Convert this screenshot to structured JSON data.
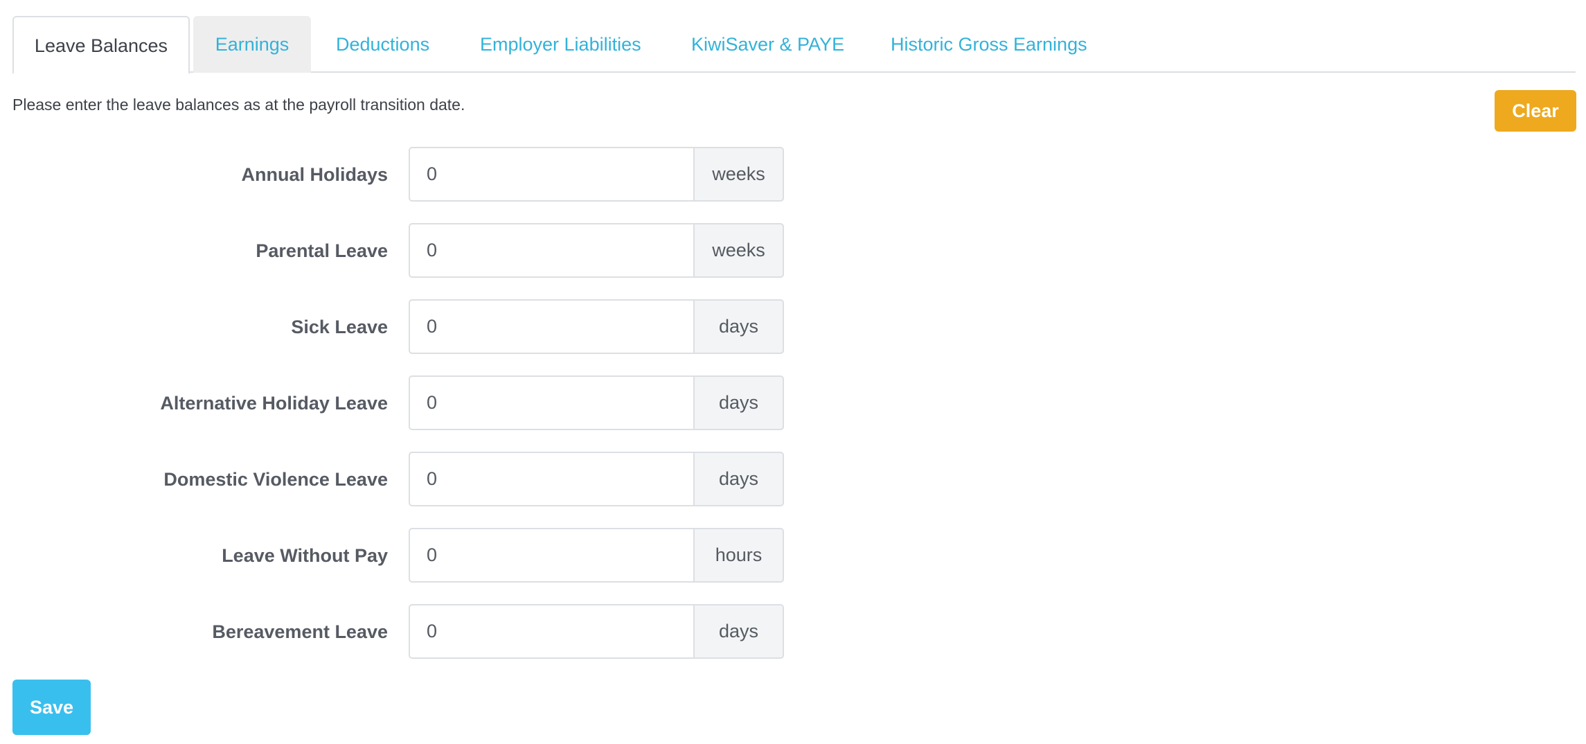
{
  "tabs": [
    {
      "label": "Leave Balances",
      "state": "active"
    },
    {
      "label": "Earnings",
      "state": "hover"
    },
    {
      "label": "Deductions",
      "state": "normal"
    },
    {
      "label": "Employer Liabilities",
      "state": "normal"
    },
    {
      "label": "KiwiSaver & PAYE",
      "state": "normal"
    },
    {
      "label": "Historic Gross Earnings",
      "state": "normal"
    }
  ],
  "intro_text": "Please enter the leave balances as at the payroll transition date.",
  "clear_label": "Clear",
  "save_label": "Save",
  "fields": [
    {
      "label": "Annual Holidays",
      "value": "0",
      "unit": "weeks"
    },
    {
      "label": "Parental Leave",
      "value": "0",
      "unit": "weeks"
    },
    {
      "label": "Sick Leave",
      "value": "0",
      "unit": "days"
    },
    {
      "label": "Alternative Holiday Leave",
      "value": "0",
      "unit": "days"
    },
    {
      "label": "Domestic Violence Leave",
      "value": "0",
      "unit": "days"
    },
    {
      "label": "Leave Without Pay",
      "value": "0",
      "unit": "hours"
    },
    {
      "label": "Bereavement Leave",
      "value": "0",
      "unit": "days"
    }
  ],
  "colors": {
    "link": "#33b2d9",
    "clear_button": "#eea91e",
    "save_button": "#39bfee"
  }
}
